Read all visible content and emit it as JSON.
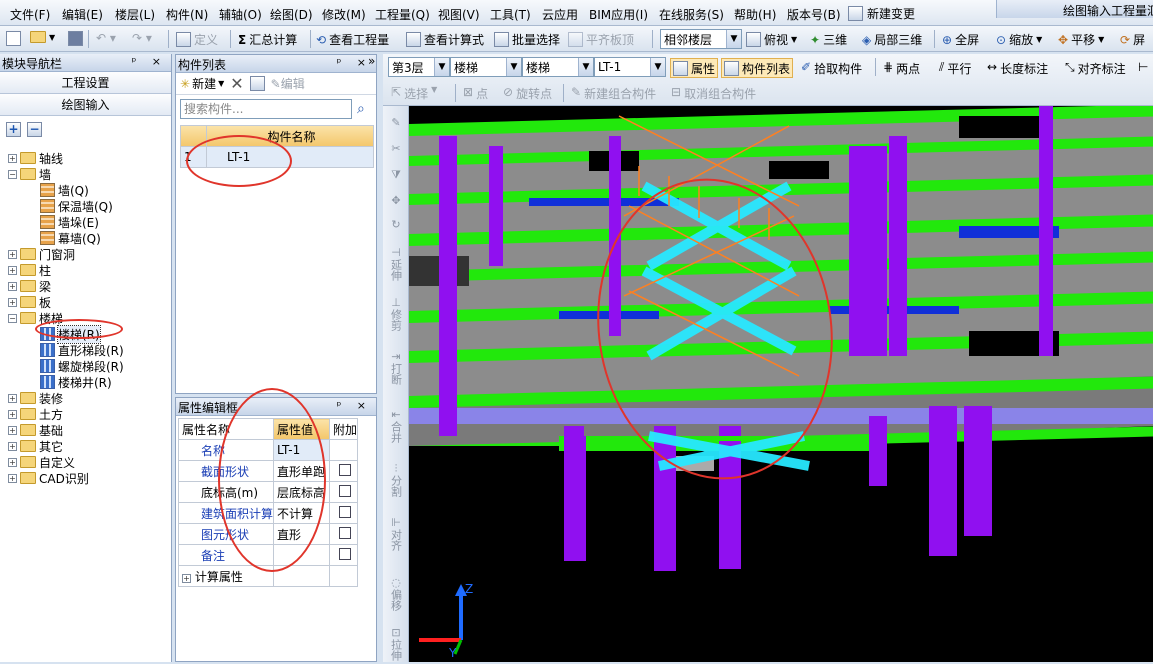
{
  "menu": [
    "文件(F)",
    "编辑(E)",
    "楼层(L)",
    "构件(N)",
    "辅轴(O)",
    "绘图(D)",
    "修改(M)",
    "工程量(Q)",
    "视图(V)",
    "工具(T)",
    "云应用",
    "BIM应用(I)",
    "在线服务(S)",
    "帮助(H)",
    "版本号(B)"
  ],
  "menu_new_change": "新建变更",
  "title_text": "绘图输入工程量汇",
  "toolbar1": {
    "define": "定义",
    "sum_calc": "汇总计算",
    "view_qty": "查看工程量",
    "view_formula": "查看计算式",
    "batch_select": "批量选择",
    "align_slab": "平齐板顶",
    "floor_select": "相邻楼层",
    "top_view": "俯视",
    "three_d": "三维",
    "local_3d": "局部三维",
    "fullscreen": "全屏",
    "zoom": "缩放",
    "pan": "平移",
    "screen": "屏"
  },
  "nav": {
    "title": "模块导航栏",
    "project_settings": "工程设置",
    "drawing_input": "绘图输入",
    "tree": [
      {
        "label": "轴线",
        "type": "folder",
        "expanded": false
      },
      {
        "label": "墙",
        "type": "folder",
        "expanded": true
      },
      {
        "label": "墙(Q)",
        "type": "child"
      },
      {
        "label": "保温墙(Q)",
        "type": "child"
      },
      {
        "label": "墙垛(E)",
        "type": "child"
      },
      {
        "label": "幕墙(Q)",
        "type": "child"
      },
      {
        "label": "门窗洞",
        "type": "folder",
        "expanded": false
      },
      {
        "label": "柱",
        "type": "folder",
        "expanded": false
      },
      {
        "label": "梁",
        "type": "folder",
        "expanded": false
      },
      {
        "label": "板",
        "type": "folder",
        "expanded": false
      },
      {
        "label": "楼梯",
        "type": "folder",
        "expanded": true
      },
      {
        "label": "楼梯(R)",
        "type": "child",
        "selected": true
      },
      {
        "label": "直形梯段(R)",
        "type": "child"
      },
      {
        "label": "螺旋梯段(R)",
        "type": "child"
      },
      {
        "label": "楼梯井(R)",
        "type": "child"
      },
      {
        "label": "装修",
        "type": "folder",
        "expanded": false
      },
      {
        "label": "土方",
        "type": "folder",
        "expanded": false
      },
      {
        "label": "基础",
        "type": "folder",
        "expanded": false
      },
      {
        "label": "其它",
        "type": "folder",
        "expanded": false
      },
      {
        "label": "自定义",
        "type": "folder",
        "expanded": false
      },
      {
        "label": "CAD识别",
        "type": "folder",
        "expanded": false
      }
    ]
  },
  "complist": {
    "title": "构件列表",
    "new_label": "新建",
    "edit_label": "编辑",
    "search_placeholder": "搜索构件...",
    "col_header": "构件名称",
    "rows": [
      {
        "index": "1",
        "name": "LT-1"
      }
    ]
  },
  "props": {
    "title": "属性编辑框",
    "headers": [
      "属性名称",
      "属性值",
      "附加"
    ],
    "rows": [
      {
        "name": "名称",
        "value": "LT-1"
      },
      {
        "name": "截面形状",
        "value": "直形单跑"
      },
      {
        "name": "底标高(m)",
        "value": "层底标高"
      },
      {
        "name": "建筑面积计算",
        "value": "不计算"
      },
      {
        "name": "图元形状",
        "value": "直形"
      },
      {
        "name": "备注",
        "value": ""
      }
    ],
    "calc_props": "计算属性"
  },
  "cadtool": {
    "floor": "第3层",
    "type1": "楼梯",
    "type2": "楼梯",
    "comp": "LT-1",
    "attr": "属性",
    "complist": "构件列表",
    "pick": "拾取构件",
    "two_points": "两点",
    "parallel": "平行",
    "length_dim": "长度标注",
    "align_dim": "对齐标注",
    "select": "选择",
    "point": "点",
    "rotate_point": "旋转点",
    "new_group": "新建组合构件",
    "cancel_group": "取消组合构件"
  },
  "vertical_tools": [
    "延伸",
    "修剪",
    "打断",
    "合并",
    "分割",
    "对齐",
    "偏移",
    "拉伸"
  ],
  "axis": {
    "z": "Z",
    "y": "Y"
  }
}
